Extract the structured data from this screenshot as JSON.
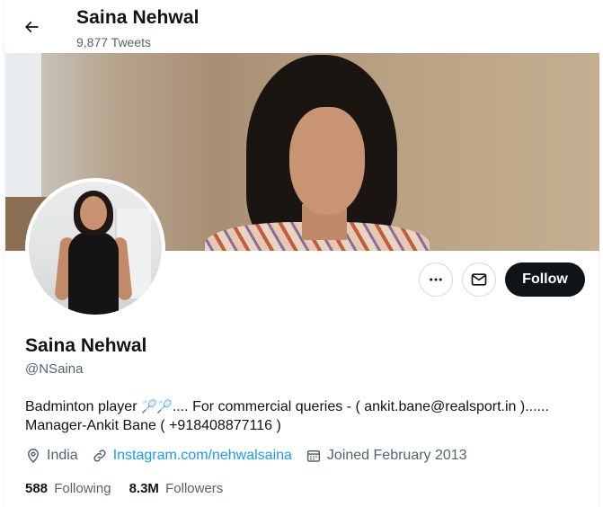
{
  "header": {
    "title": "Saina Nehwal",
    "tweet_count": "9,877 Tweets"
  },
  "actions": {
    "follow_label": "Follow"
  },
  "profile": {
    "name": "Saina Nehwal",
    "handle": "@NSaina",
    "bio_line1_pre": "Badminton player ",
    "bio_emoji": "🏸🏸",
    "bio_line1_post": ".... For commercial queries - ( ankit.bane@realsport.in )......",
    "bio_line2": "Manager-Ankit Bane ( +918408877116 )",
    "location": "India",
    "website": "Instagram.com/nehwalsaina",
    "joined": "Joined February 2013"
  },
  "stats": {
    "following_count": "588",
    "following_label": "Following",
    "followers_count": "8.3M",
    "followers_label": "Followers"
  },
  "icons": {
    "back": "arrow-left-icon",
    "more": "more-dots-icon",
    "message": "envelope-icon",
    "location": "location-pin-icon",
    "link": "link-icon",
    "calendar": "calendar-icon"
  },
  "colors": {
    "link": "#1d9bf0",
    "secondary_text": "#536471",
    "follow_bg": "#0f1419"
  }
}
